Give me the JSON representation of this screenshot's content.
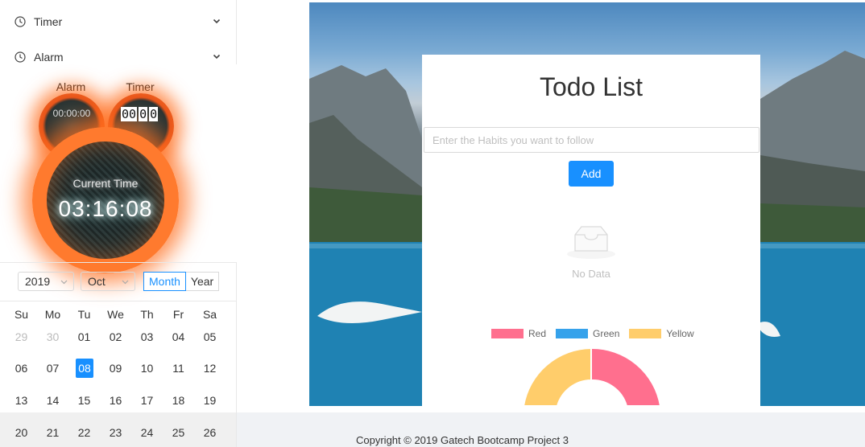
{
  "sidebar": {
    "menu": [
      {
        "label": "Timer",
        "icon": "clock-icon"
      },
      {
        "label": "Alarm",
        "icon": "clock-icon"
      }
    ]
  },
  "clock": {
    "alarm_label": "Alarm",
    "timer_label": "Timer",
    "alarm_value": "00:00:00",
    "timer_digits": [
      "00",
      "0",
      "0"
    ],
    "current_label": "Current Time",
    "current_time": "03:16:08"
  },
  "calendar": {
    "year": "2019",
    "month": "Oct",
    "modes": [
      "Month",
      "Year"
    ],
    "active_mode": "Month",
    "weekdays": [
      "Su",
      "Mo",
      "Tu",
      "We",
      "Th",
      "Fr",
      "Sa"
    ],
    "weeks": [
      [
        "29",
        "30",
        "01",
        "02",
        "03",
        "04",
        "05"
      ],
      [
        "06",
        "07",
        "08",
        "09",
        "10",
        "11",
        "12"
      ],
      [
        "13",
        "14",
        "15",
        "16",
        "17",
        "18",
        "19"
      ],
      [
        "20",
        "21",
        "22",
        "23",
        "24",
        "25",
        "26"
      ]
    ],
    "selected_day": "08"
  },
  "todo": {
    "title": "Todo List",
    "input_placeholder": "Enter the Habits you want to follow",
    "add_label": "Add",
    "empty_text": "No Data"
  },
  "chart_data": {
    "type": "pie",
    "categories": [
      "Red",
      "Green",
      "Yellow"
    ],
    "colors": [
      "#ff6f8e",
      "#36a2eb",
      "#ffcd6b"
    ],
    "legend": "top"
  },
  "footer": {
    "text": "Copyright © 2019 Gatech Bootcamp Project 3"
  }
}
